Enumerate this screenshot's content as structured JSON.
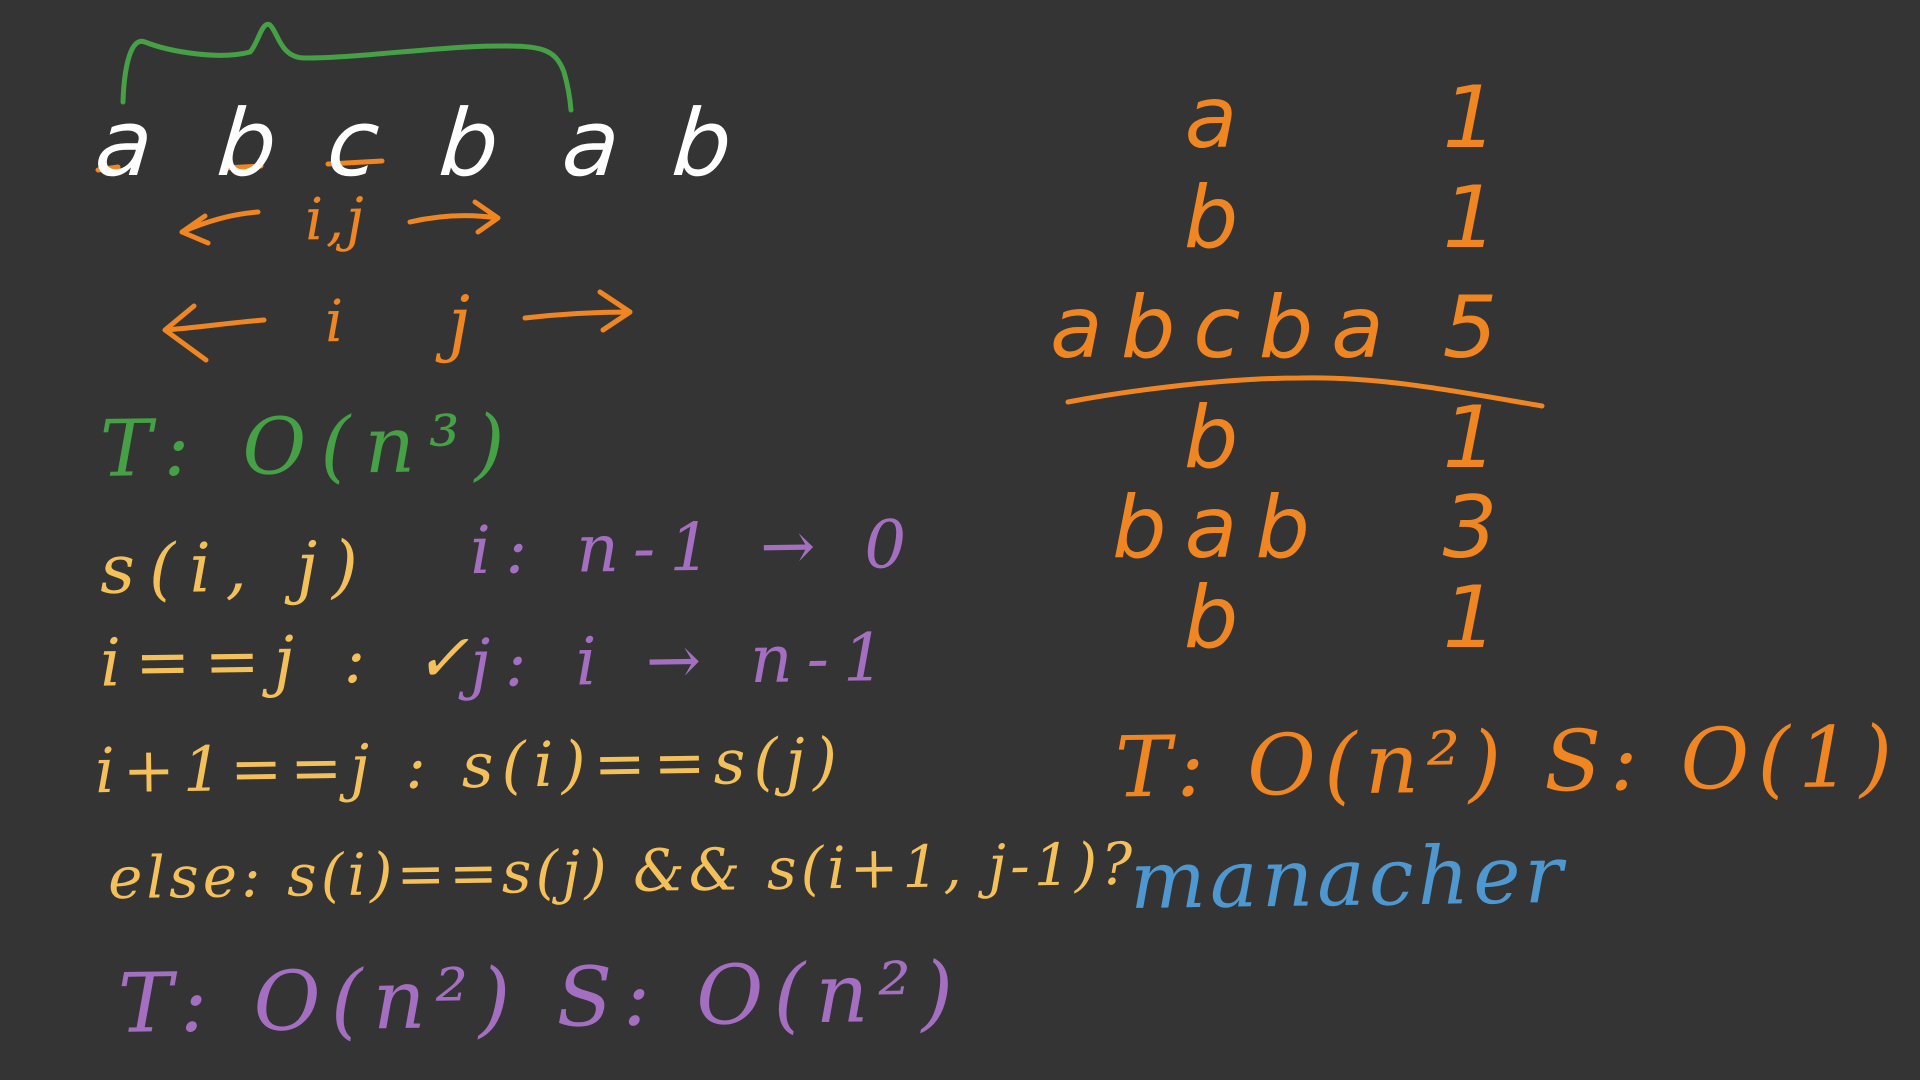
{
  "top_string": [
    "a",
    "b",
    "c",
    "b",
    "a",
    "b"
  ],
  "pointers": {
    "row1": "i,j",
    "row2_i": "i",
    "row2_j": "j"
  },
  "left_notes": {
    "t_brute": "T: O(n³)",
    "s_ij": "s(i, j)",
    "i_range": "i: n-1 → 0",
    "case1": "i==j : ✓",
    "j_range": "j: i → n-1",
    "case2": "i+1==j : s(i)==s(j)",
    "case3": "else: s(i)==s(j) && s(i+1, j-1)?",
    "dp_complexity": "T: O(n²)  S: O(n²)"
  },
  "right_table": {
    "rows": [
      {
        "str": "a",
        "len": "1"
      },
      {
        "str": "b",
        "len": "1"
      },
      {
        "str": "abcba",
        "len": "5"
      },
      {
        "str": "b",
        "len": "1"
      },
      {
        "str": "bab",
        "len": "3"
      },
      {
        "str": "b",
        "len": "1"
      }
    ],
    "center_complexity": "T: O(n²)  S: O(1)",
    "manacher": "manacher"
  },
  "colors": {
    "background": "#343434",
    "white": "#ffffff",
    "orange": "#ef8622",
    "green": "#45a046",
    "yellow": "#f4c05a",
    "purple": "#a56fc1",
    "blue": "#4f97cf"
  }
}
